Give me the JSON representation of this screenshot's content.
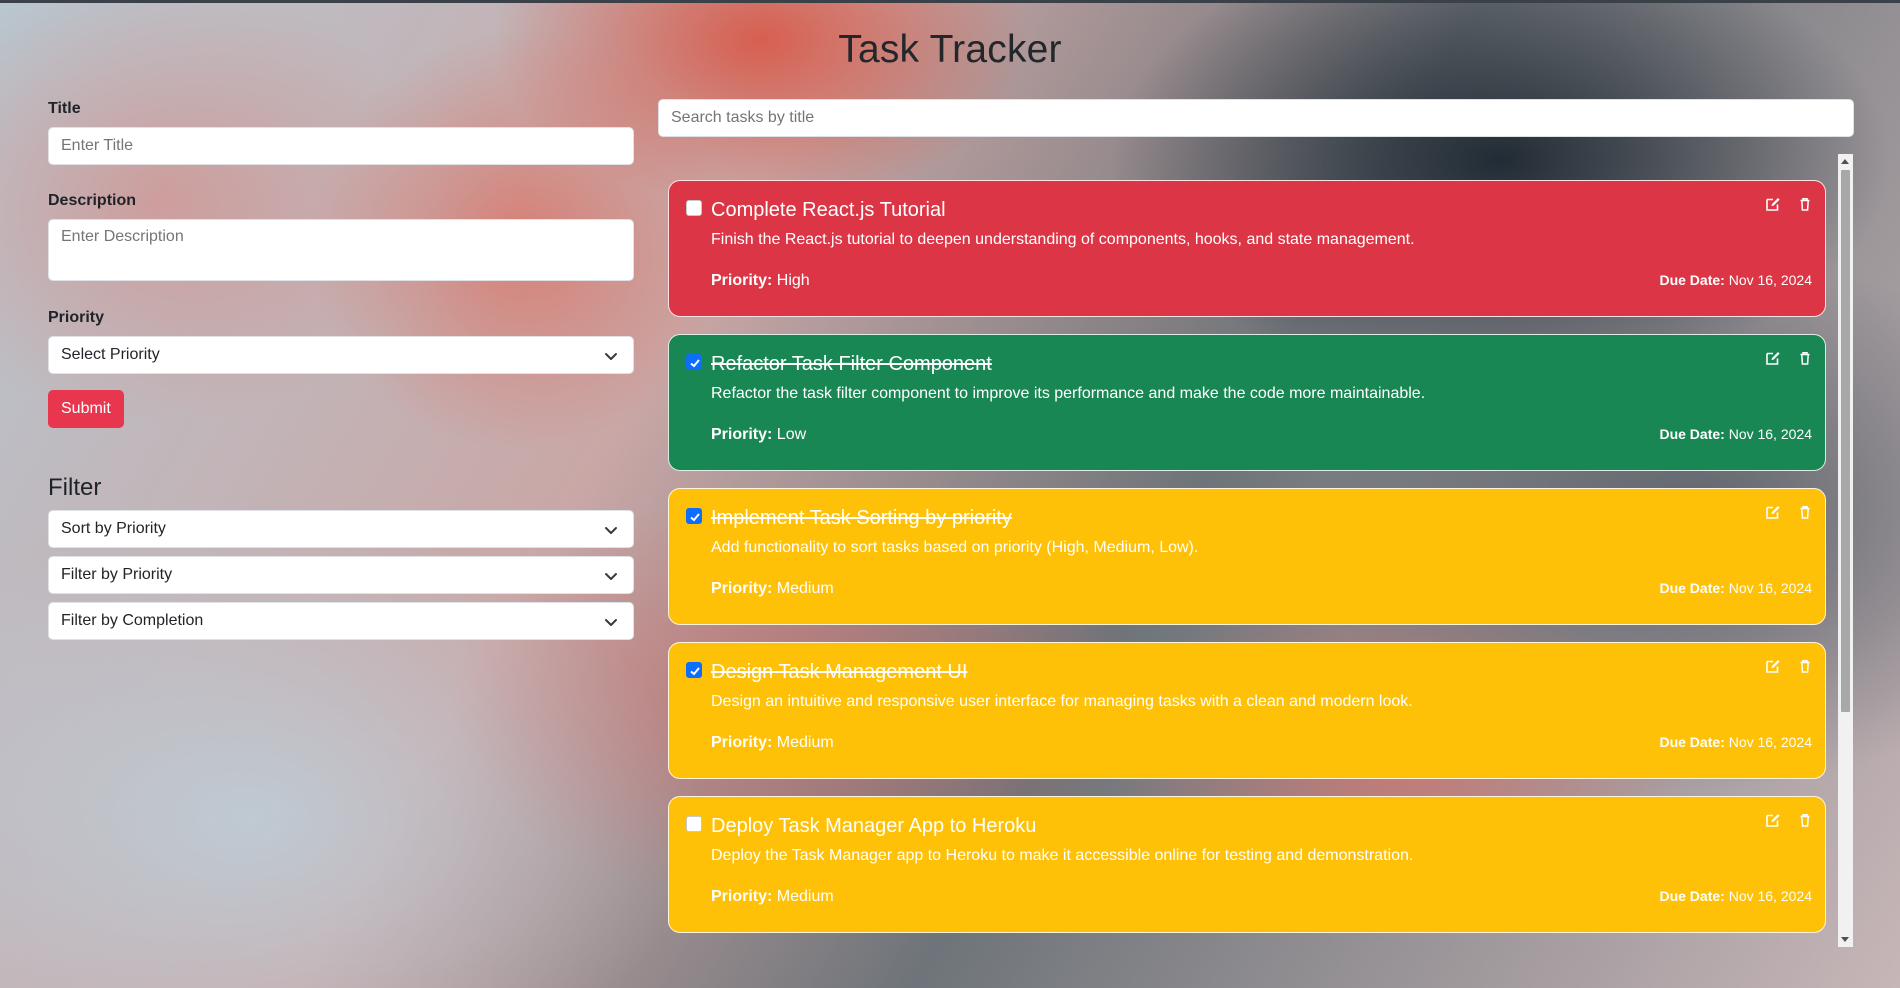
{
  "app": {
    "title": "Task Tracker"
  },
  "form": {
    "title_label": "Title",
    "title_placeholder": "Enter Title",
    "description_label": "Description",
    "description_placeholder": "Enter Description",
    "priority_label": "Priority",
    "priority_selected": "Select Priority",
    "submit_label": "Submit"
  },
  "filter": {
    "heading": "Filter",
    "sort_selected": "Sort by Priority",
    "priority_selected": "Filter by Priority",
    "completion_selected": "Filter by Completion"
  },
  "search": {
    "placeholder": "Search tasks by title"
  },
  "labels": {
    "priority": "Priority:",
    "due_date": "Due Date:"
  },
  "colors": {
    "high": "#dc3545",
    "low": "#198754",
    "medium": "#ffc107",
    "submit": "#e8364e",
    "checkbox": "#0d6efd"
  },
  "tasks": [
    {
      "title": "Complete React.js Tutorial",
      "description": "Finish the React.js tutorial to deepen understanding of components, hooks, and state management.",
      "priority": "High",
      "due": "Nov 16, 2024",
      "completed": false
    },
    {
      "title": "Refactor Task Filter Component",
      "description": "Refactor the task filter component to improve its performance and make the code more maintainable.",
      "priority": "Low",
      "due": "Nov 16, 2024",
      "completed": true
    },
    {
      "title": "Implement Task Sorting by priority",
      "description": "Add functionality to sort tasks based on priority (High, Medium, Low).",
      "priority": "Medium",
      "due": "Nov 16, 2024",
      "completed": true
    },
    {
      "title": "Design Task Management UI",
      "description": "Design an intuitive and responsive user interface for managing tasks with a clean and modern look.",
      "priority": "Medium",
      "due": "Nov 16, 2024",
      "completed": true
    },
    {
      "title": "Deploy Task Manager App to Heroku",
      "description": "Deploy the Task Manager app to Heroku to make it accessible online for testing and demonstration.",
      "priority": "Medium",
      "due": "Nov 16, 2024",
      "completed": false
    }
  ]
}
